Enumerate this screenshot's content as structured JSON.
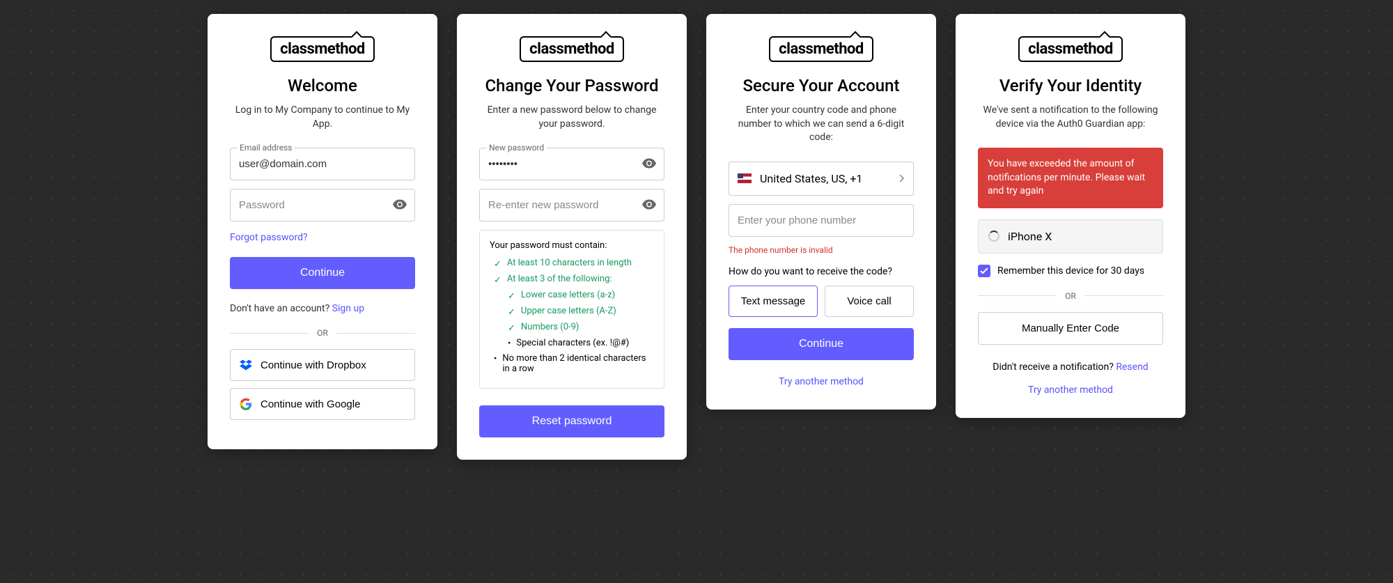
{
  "brand": "classmethod",
  "login": {
    "title": "Welcome",
    "subtitle": "Log in to My Company to continue to My App.",
    "email_label": "Email address",
    "email_value": "user@domain.com",
    "password_placeholder": "Password",
    "forgot": "Forgot password?",
    "continue": "Continue",
    "no_account": "Don't have an account?",
    "signup": "Sign up",
    "or": "OR",
    "dropbox": "Continue with Dropbox",
    "google": "Continue with Google"
  },
  "password": {
    "title": "Change Your Password",
    "subtitle": "Enter a new password below to change your password.",
    "new_label": "New password",
    "new_value": "••••••••",
    "confirm_placeholder": "Re-enter new password",
    "rules_title": "Your password must contain:",
    "rule1": "At least 10 characters in length",
    "rule2": "At least 3 of the following:",
    "rule_lower": "Lower case letters (a-z)",
    "rule_upper": "Upper case letters (A-Z)",
    "rule_numbers": "Numbers (0-9)",
    "rule_special": "Special characters (ex. !@#)",
    "rule_identical": "No more than 2 identical characters in a row",
    "reset": "Reset password"
  },
  "secure": {
    "title": "Secure Your Account",
    "subtitle": "Enter your country code and phone number to which we can send a 6-digit code:",
    "country": "United States, US, +1",
    "phone_placeholder": "Enter your phone number",
    "error": "The phone number is invalid",
    "how_receive": "How do you want to receive the code?",
    "text_msg": "Text message",
    "voice": "Voice call",
    "continue": "Continue",
    "try_another": "Try another method"
  },
  "verify": {
    "title": "Verify Your Identity",
    "subtitle": "We've sent a notification to the following device via the Auth0 Guardian app:",
    "alert": "You have exceeded the amount of notifications per minute. Please wait and try again",
    "device": "iPhone X",
    "remember": "Remember this device for 30 days",
    "or": "OR",
    "manual": "Manually Enter Code",
    "no_notif": "Didn't receive a notification?",
    "resend": "Resend",
    "try_another": "Try another method"
  }
}
